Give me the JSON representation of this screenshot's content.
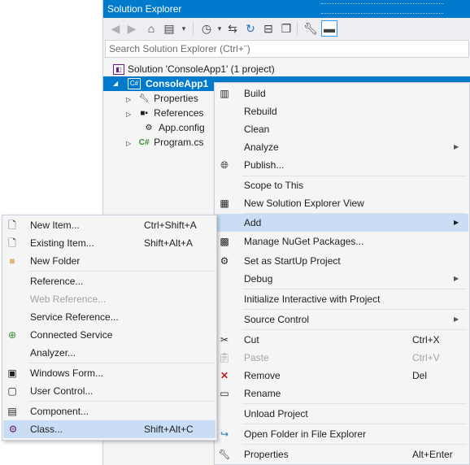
{
  "solution_explorer": {
    "title": "Solution Explorer",
    "search_placeholder": "Search Solution Explorer (Ctrl+¨)",
    "toolbar_icons": [
      "back-icon",
      "forward-icon",
      "home-icon",
      "switch-views-icon",
      "pending-changes-filter-icon",
      "sync-icon",
      "refresh-icon",
      "collapse-all-icon",
      "show-all-files-icon",
      "properties-icon",
      "preview-icon"
    ],
    "tree": {
      "solution": "Solution 'ConsoleApp1' (1 project)",
      "project": "ConsoleApp1",
      "children": [
        "Properties",
        "References",
        "App.config",
        "Program.cs"
      ]
    }
  },
  "project_menu": {
    "items": [
      {
        "label": "Build",
        "icon": "build-icon"
      },
      {
        "label": "Rebuild"
      },
      {
        "label": "Clean"
      },
      {
        "label": "Analyze",
        "submenu": true
      },
      {
        "label": "Publish...",
        "icon": "globe-icon"
      },
      {
        "label": "Scope to This"
      },
      {
        "label": "New Solution Explorer View",
        "icon": "new-view-icon"
      },
      {
        "label": "Add",
        "submenu": true,
        "highlighted": true
      },
      {
        "label": "Manage NuGet Packages...",
        "icon": "nuget-icon"
      },
      {
        "label": "Set as StartUp Project",
        "icon": "gear-icon"
      },
      {
        "label": "Debug",
        "submenu": true
      },
      {
        "label": "Initialize Interactive with Project"
      },
      {
        "label": "Source Control",
        "submenu": true
      },
      {
        "label": "Cut",
        "shortcut": "Ctrl+X",
        "icon": "scissors-icon"
      },
      {
        "label": "Paste",
        "shortcut": "Ctrl+V",
        "icon": "paste-icon",
        "disabled": true
      },
      {
        "label": "Remove",
        "shortcut": "Del",
        "icon": "remove-icon"
      },
      {
        "label": "Rename",
        "icon": "rename-icon"
      },
      {
        "label": "Unload Project"
      },
      {
        "label": "Open Folder in File Explorer",
        "icon": "open-folder-icon"
      },
      {
        "label": "Properties",
        "shortcut": "Alt+Enter",
        "icon": "wrench-icon"
      }
    ]
  },
  "add_menu": {
    "items": [
      {
        "label": "New Item...",
        "shortcut": "Ctrl+Shift+A",
        "icon": "new-item-icon"
      },
      {
        "label": "Existing Item...",
        "shortcut": "Shift+Alt+A",
        "icon": "existing-item-icon"
      },
      {
        "label": "New Folder",
        "icon": "folder-icon"
      },
      {
        "label": "Reference..."
      },
      {
        "label": "Web Reference...",
        "disabled": true
      },
      {
        "label": "Service Reference..."
      },
      {
        "label": "Connected Service",
        "icon": "connected-service-icon"
      },
      {
        "label": "Analyzer..."
      },
      {
        "label": "Windows Form...",
        "icon": "windows-form-icon"
      },
      {
        "label": "User Control...",
        "icon": "user-control-icon"
      },
      {
        "label": "Component...",
        "icon": "component-icon"
      },
      {
        "label": "Class...",
        "shortcut": "Shift+Alt+C",
        "icon": "class-icon",
        "highlighted": true
      }
    ]
  }
}
